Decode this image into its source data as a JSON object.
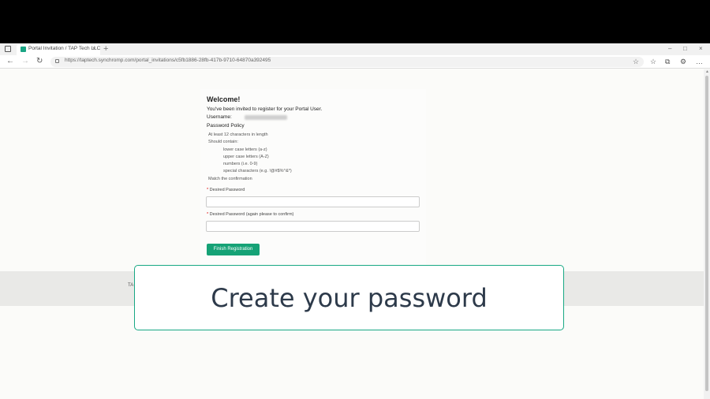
{
  "browser": {
    "tab_title": "Portal Invitation / TAP Tech LLC",
    "url": "https://taptech.synchromp.com/portal_invitations/c5fb1886-28fb-417b-9710-64870a392495"
  },
  "page": {
    "welcome": "Welcome!",
    "invited_text": "You've been invited to register for your Portal User.",
    "username_label": "Username:",
    "policy_title": "Password Policy",
    "policy": {
      "length": "At least 12 characters in length",
      "should_contain": "Should contain:",
      "lower": "lower case letters (a-z)",
      "upper": "upper case letters (A-Z)",
      "numbers": "numbers (i.e. 0-9)",
      "special": "special characters (e.g. !@#$%^&*)",
      "match": "Match the confirmation"
    },
    "desired_password_label": "Desired Password",
    "confirm_password_label": "Desired Password (again please to confirm)",
    "required_marker": "*",
    "finish_button": "Finish Registration"
  },
  "footer": {
    "text": "TA"
  },
  "overlay": {
    "caption": "Create your password"
  },
  "colors": {
    "accent": "#15a276",
    "overlay_border": "#18a884",
    "overlay_text": "#2d3a4a"
  }
}
